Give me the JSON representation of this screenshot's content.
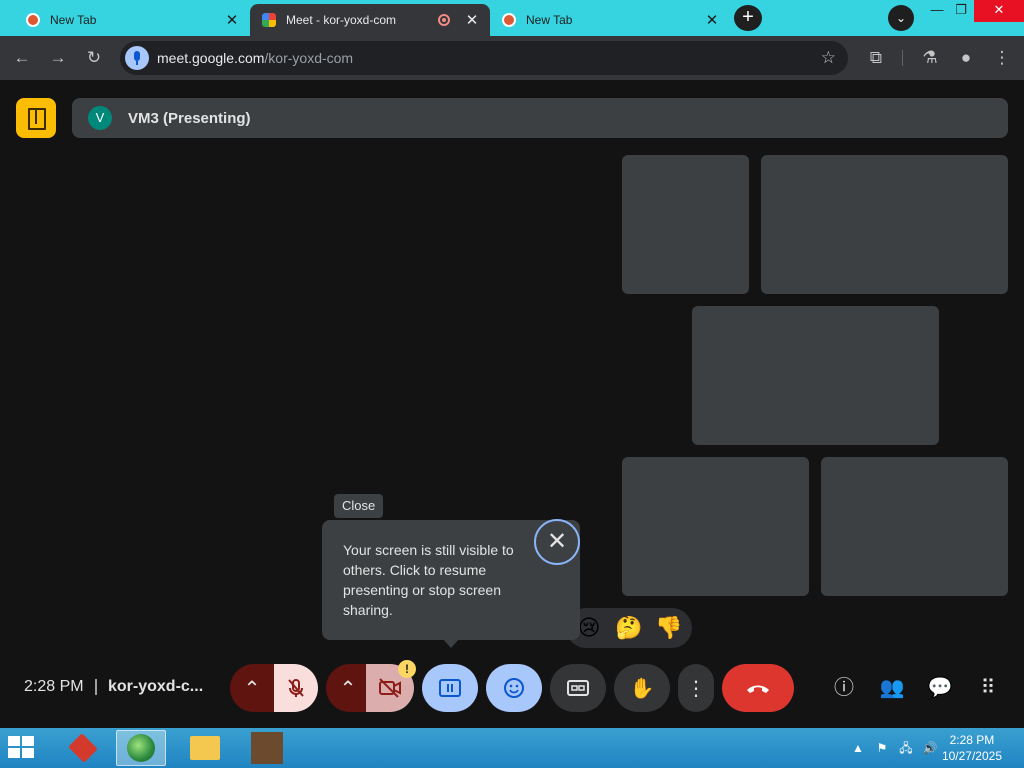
{
  "browser": {
    "tabs": [
      {
        "title": "New Tab",
        "favicon": "duckduckgo-icon",
        "active": false
      },
      {
        "title": "Meet - kor-yoxd-com",
        "favicon": "google-meet-icon",
        "active": true,
        "recording": true
      },
      {
        "title": "New Tab",
        "favicon": "duckduckgo-icon",
        "active": false
      }
    ],
    "url_host": "meet.google.com",
    "url_path": "/kor-yoxd-com"
  },
  "meet": {
    "presenter_initial": "V",
    "presenter_label": "VM3 (Presenting)",
    "close_tooltip": "Close",
    "popup_text": "Your screen is still visible to others. Click to resume presenting or stop screen sharing.",
    "popup_close_glyph": "✕",
    "reactions": [
      "😢",
      "🤔",
      "👎"
    ],
    "time": "2:28 PM",
    "meeting_code": "kor-yoxd-c...",
    "warning_badge": "!",
    "accent_colors": {
      "leave": "#dc362e",
      "active_control": "#a8c7fa",
      "room": "#fbbc04"
    }
  },
  "taskbar": {
    "time": "2:28 PM",
    "date": "10/27/2025"
  }
}
